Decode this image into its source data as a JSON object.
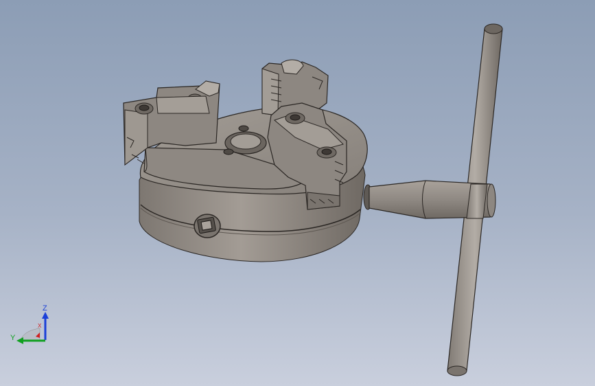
{
  "viewport": {
    "background_top": "#8c9db5",
    "background_bottom": "#c9cfdd"
  },
  "model": {
    "parts": [
      "chuck-body",
      "jaw-1",
      "jaw-2",
      "jaw-3",
      "chuck-key"
    ],
    "body_color": "#8a837b",
    "edge_color": "#2a2623"
  },
  "triad": {
    "labels": {
      "z": "Z",
      "y": "Y",
      "x": "X"
    },
    "colors": {
      "z": "#1a3fd8",
      "y": "#10a020",
      "x": "#d02020"
    }
  }
}
